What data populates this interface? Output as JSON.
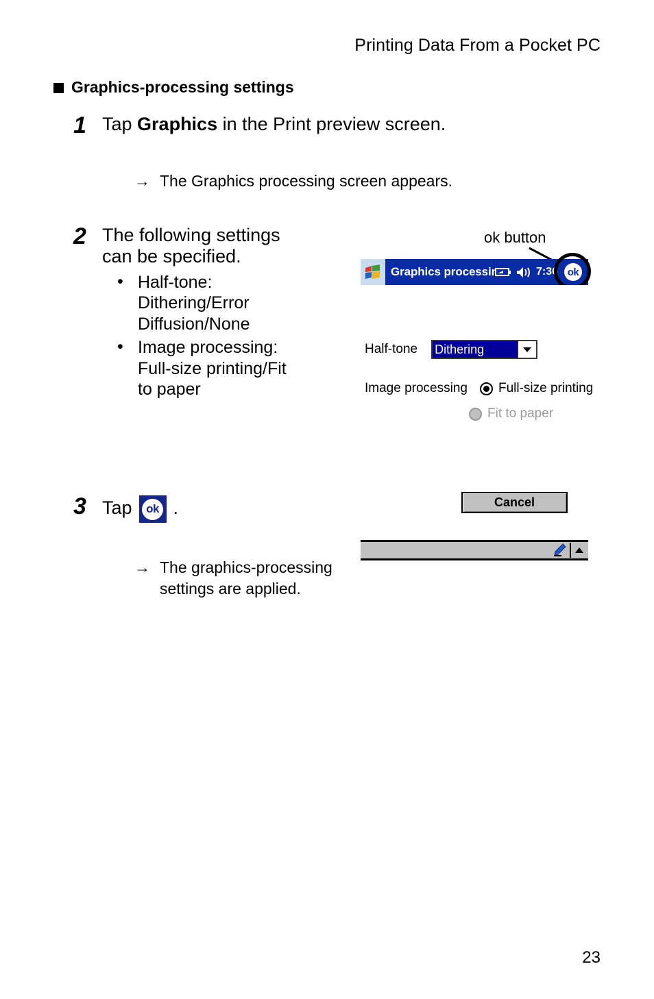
{
  "header": {
    "running_title": "Printing Data From a Pocket PC"
  },
  "section": {
    "heading": "Graphics-processing settings"
  },
  "steps": [
    {
      "number": "1",
      "text_before": "Tap ",
      "bold": "Graphics",
      "text_after": " in the Print preview screen.",
      "result": "The Graphics processing screen appears."
    },
    {
      "number": "2",
      "text": "The following settings can be specified.",
      "bullets": [
        "Half-tone: Dithering/Error Diffusion/None",
        "Image processing: Full-size printing/Fit to paper"
      ]
    },
    {
      "number": "3",
      "text_before": "Tap",
      "text_after": ".",
      "icon": "ok-icon",
      "result": "The graphics-processing settings are applied."
    }
  ],
  "arrow_symbol": "→",
  "callout": {
    "label": "ok button"
  },
  "device": {
    "titlebar": {
      "start_icon": "windows-flag-icon",
      "title": "Graphics processing",
      "battery_icon": "battery-icon",
      "volume_icon": "speaker-icon",
      "time": "7:36",
      "ok_label": "ok"
    },
    "form": {
      "halftone_label": "Half-tone",
      "halftone_value": "Dithering",
      "halftone_options": [
        "Dithering",
        "Error Diffusion",
        "None"
      ],
      "image_processing_label": "Image processing",
      "radio_fullsize_label": "Full-size printing",
      "radio_fullsize_selected": true,
      "radio_fit_label": "Fit to paper",
      "radio_fit_selected": false,
      "radio_fit_disabled": true,
      "cancel_label": "Cancel"
    },
    "taskbar": {
      "sip_icon": "pen-icon",
      "sip_caret": "caret-up-icon"
    }
  },
  "footer": {
    "page_number": "23"
  },
  "colors": {
    "titlebar_blue": "#0a2ba6",
    "selection_blue": "#000099",
    "ok_glyph_blue": "#14268c",
    "button_face": "#c0c0c0",
    "disabled_gray": "#9a9a9a"
  }
}
